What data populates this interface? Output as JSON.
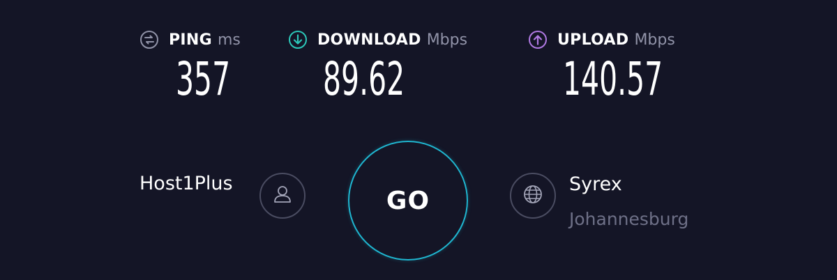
{
  "metrics": {
    "ping": {
      "label": "PING",
      "unit": "ms",
      "value": "357",
      "icon": "ping-icon",
      "color": "#9193a8"
    },
    "download": {
      "label": "DOWNLOAD",
      "unit": "Mbps",
      "value": "89.62",
      "icon": "download-arrow-icon",
      "color": "#2cc8b9"
    },
    "upload": {
      "label": "UPLOAD",
      "unit": "Mbps",
      "value": "140.57",
      "icon": "upload-arrow-icon",
      "color": "#b17ae4"
    }
  },
  "provider": {
    "name": "Host1Plus",
    "icon": "user-icon"
  },
  "go_button": {
    "label": "GO",
    "color": "#1fb6d0"
  },
  "server": {
    "name": "Syrex",
    "location": "Johannesburg",
    "icon": "globe-icon"
  },
  "colors": {
    "background": "#141526",
    "muted_text": "#6e7087"
  }
}
